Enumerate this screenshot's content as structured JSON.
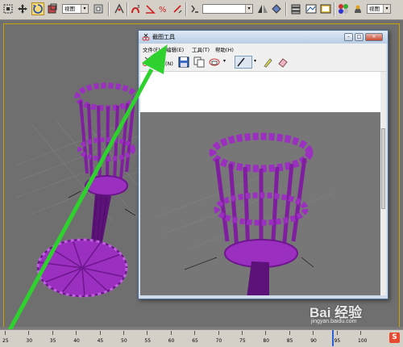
{
  "toolbar": {
    "view_select_1": "视图",
    "view_select_2": "视图",
    "coord_field": ""
  },
  "window": {
    "title": "截图工具",
    "menus": [
      "文件(F)",
      "编辑(E)",
      "工具(T)",
      "帮助(H)"
    ],
    "new_label": "新建(N)",
    "buttons": {
      "minimize": "–",
      "maximize": "□",
      "close": "×"
    }
  },
  "timeline": {
    "ticks": [
      "25",
      "30",
      "35",
      "40",
      "45",
      "50",
      "55",
      "60",
      "65",
      "70",
      "75",
      "80",
      "85",
      "90",
      "95",
      "100"
    ]
  },
  "watermark": {
    "brand": "Bai 经验",
    "url": "jingyan.baidu.com"
  },
  "ime": {
    "label": "S"
  },
  "colors": {
    "model_purple": "#9b2fbf",
    "arrow_green": "#2ed12e",
    "viewport_bg": "#6f6f6f",
    "viewport_frame": "#c9a400"
  }
}
